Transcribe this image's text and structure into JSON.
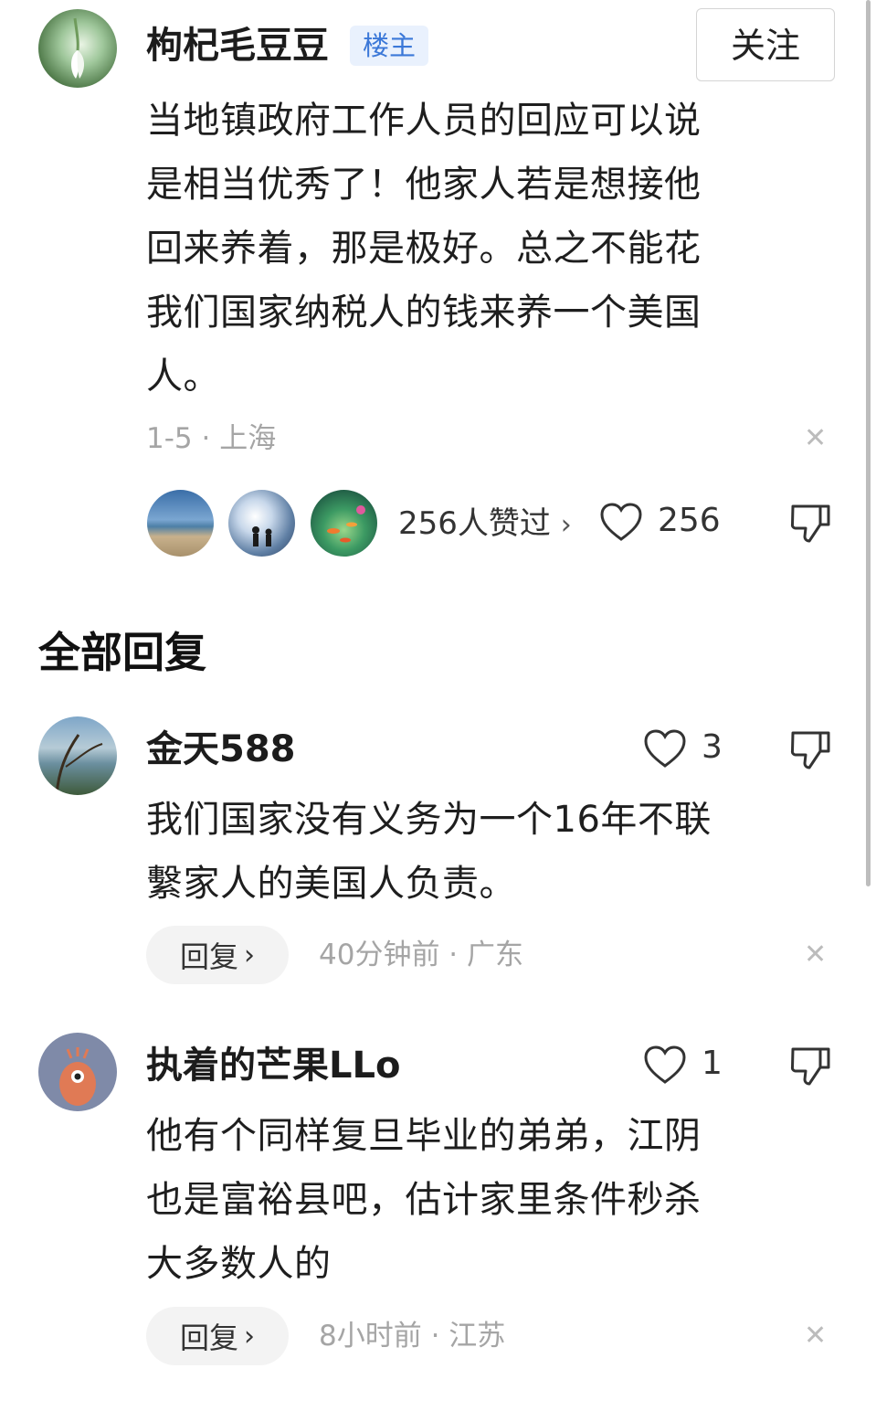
{
  "op": {
    "username": "枸杞毛豆豆",
    "badge": "楼主",
    "follow_label": "关注",
    "content_lines": [
      "当地镇政府工作人员的回应可以说",
      "是相当优秀了！他家人若是想接他",
      "回来养着，那是极好。总之不能花",
      "我们国家纳税人的钱来养一个美国",
      "人。"
    ],
    "meta": "1-5 · 上海",
    "likers_label": "256人赞过",
    "like_count": "256"
  },
  "replies_header": "全部回复",
  "replies": [
    {
      "username": "金天588",
      "like_count": "3",
      "content_lines": [
        "我们国家没有义务为一个16年不联",
        "繫家人的美国人负责。"
      ],
      "reply_label": "回复",
      "meta": "40分钟前 · 广东"
    },
    {
      "username": "执着的芒果LLo",
      "like_count": "1",
      "content_lines": [
        "他有个同样复旦毕业的弟弟，江阴",
        "也是富裕县吧，估计家里条件秒杀",
        "大多数人的"
      ],
      "reply_label": "回复",
      "meta": "8小时前 · 江苏"
    }
  ],
  "colors": {
    "badge_bg": "#e9f1fd",
    "badge_text": "#3b78d8",
    "meta_gray": "#a5a5a5",
    "reply_btn_bg": "#f3f3f3"
  }
}
